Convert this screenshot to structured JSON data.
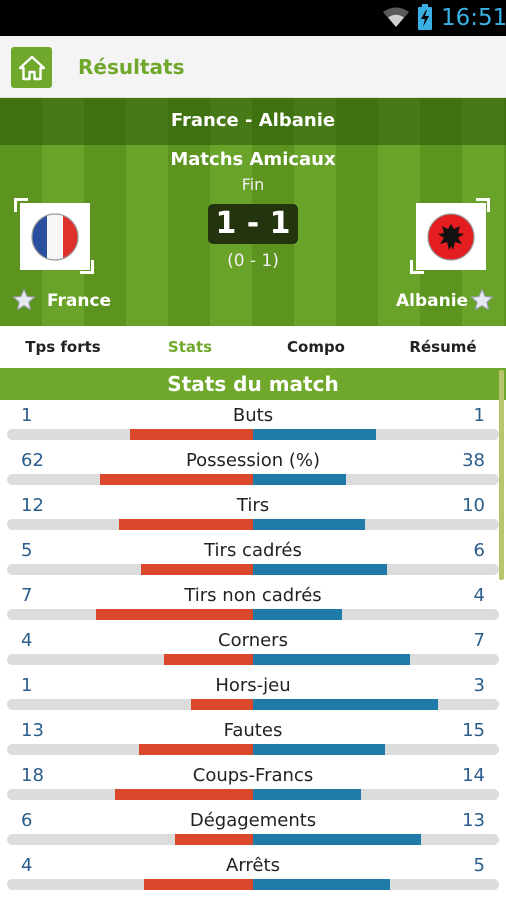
{
  "status_bar": {
    "time": "16:51",
    "icons": [
      "wifi-icon",
      "battery-charging-icon"
    ]
  },
  "action_bar": {
    "title": "Résultats",
    "icon": "home-icon"
  },
  "match": {
    "title": "France - Albanie",
    "competition": "Matchs Amicaux",
    "status": "Fin",
    "score": "1 - 1",
    "halftime": "(0 - 1)",
    "home": {
      "name": "France",
      "flag": "france-flag-icon"
    },
    "away": {
      "name": "Albanie",
      "flag": "albania-flag-icon"
    }
  },
  "tabs": [
    {
      "label": "Tps forts",
      "active": false
    },
    {
      "label": "Stats",
      "active": true
    },
    {
      "label": "Compo",
      "active": false
    },
    {
      "label": "Résumé",
      "active": false
    }
  ],
  "stats": {
    "title": "Stats du match",
    "colors": {
      "home": "#d9482b",
      "away": "#1e7aa6",
      "track": "#dcdcdc",
      "accent": "#6fa82b"
    },
    "rows": [
      {
        "label": "Buts",
        "home": "1",
        "away": "1"
      },
      {
        "label": "Possession (%)",
        "home": "62",
        "away": "38"
      },
      {
        "label": "Tirs",
        "home": "12",
        "away": "10"
      },
      {
        "label": "Tirs cadrés",
        "home": "5",
        "away": "6"
      },
      {
        "label": "Tirs non cadrés",
        "home": "7",
        "away": "4"
      },
      {
        "label": "Corners",
        "home": "4",
        "away": "7"
      },
      {
        "label": "Hors-jeu",
        "home": "1",
        "away": "3"
      },
      {
        "label": "Fautes",
        "home": "13",
        "away": "15"
      },
      {
        "label": "Coups-Francs",
        "home": "18",
        "away": "14"
      },
      {
        "label": "Dégagements",
        "home": "6",
        "away": "13"
      },
      {
        "label": "Arrêts",
        "home": "4",
        "away": "5"
      }
    ]
  }
}
